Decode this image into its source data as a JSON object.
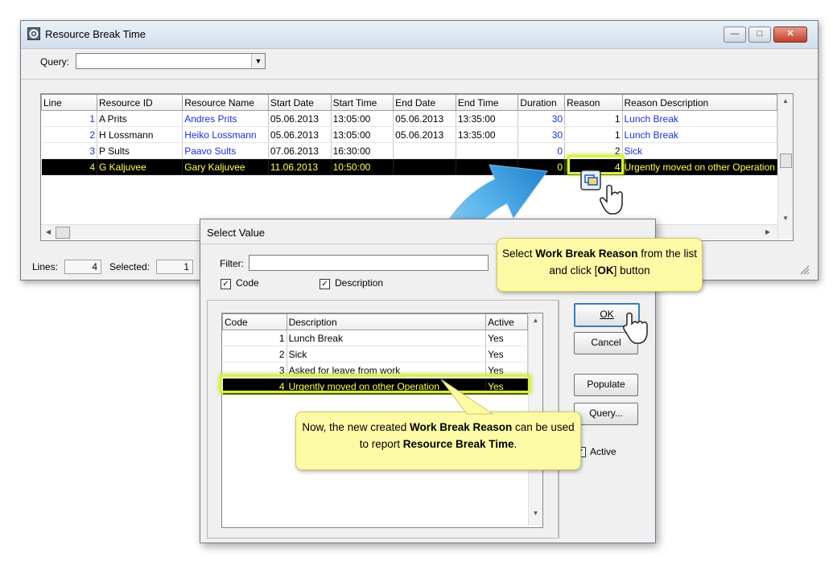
{
  "window": {
    "title": "Resource Break Time",
    "query_label": "Query:",
    "query_value": "",
    "min": "—",
    "max": "□",
    "close": "✕"
  },
  "grid": {
    "columns": [
      "Line",
      "Resource ID",
      "Resource Name",
      "Start Date",
      "Start Time",
      "End Date",
      "End Time",
      "Duration",
      "Reason",
      "Reason Description"
    ],
    "rows": [
      {
        "line": "1",
        "resource_id": "A Prits",
        "resource_name": "Andres Prits",
        "start_date": "05.06.2013",
        "start_time": "13:05:00",
        "end_date": "05.06.2013",
        "end_time": "13:35:00",
        "duration": "30",
        "reason": "1",
        "reason_desc": "Lunch Break"
      },
      {
        "line": "2",
        "resource_id": "H Lossmann",
        "resource_name": "Heiko Lossmann",
        "start_date": "05.06.2013",
        "start_time": "13:05:00",
        "end_date": "05.06.2013",
        "end_time": "13:35:00",
        "duration": "30",
        "reason": "1",
        "reason_desc": "Lunch Break"
      },
      {
        "line": "3",
        "resource_id": "P Sults",
        "resource_name": "Paavo Sults",
        "start_date": "07.06.2013",
        "start_time": "16:30:00",
        "end_date": "",
        "end_time": "",
        "duration": "0",
        "reason": "2",
        "reason_desc": "Sick"
      },
      {
        "line": "4",
        "resource_id": "G Kaljuvee",
        "resource_name": "Gary Kaljuvee",
        "start_date": "11.06.2013",
        "start_time": "10:50:00",
        "end_date": "",
        "end_time": "",
        "duration": "0",
        "reason": "4",
        "reason_desc": "Urgently moved on other Operation"
      }
    ]
  },
  "status": {
    "lines_label": "Lines:",
    "lines_value": "4",
    "selected_label": "Selected:",
    "selected_value": "1"
  },
  "dialog": {
    "title": "Select Value",
    "filter_label": "Filter:",
    "filter_value": "",
    "code_check_label": "Code",
    "desc_check_label": "Description",
    "columns": [
      "Code",
      "Description",
      "Active"
    ],
    "rows": [
      {
        "code": "1",
        "description": "Lunch Break",
        "active": "Yes"
      },
      {
        "code": "2",
        "description": "Sick",
        "active": "Yes"
      },
      {
        "code": "3",
        "description": "Asked for leave from work",
        "active": "Yes"
      },
      {
        "code": "4",
        "description": "Urgently moved on other Operation",
        "active": "Yes"
      }
    ],
    "ok": "OK",
    "cancel": "Cancel",
    "populate": "Populate",
    "query": "Query...",
    "active_label": "Active"
  },
  "callout1": {
    "p1": "Select ",
    "b1": "Work Break Reason",
    "p2": " from the list and click [",
    "b2": "OK",
    "p3": "] button"
  },
  "callout2": {
    "p1": "Now, the new created ",
    "b1": "Work Break Reason",
    "p2": " can be used to report ",
    "b2": "Resource Break Time",
    "p3": "."
  },
  "colors": {
    "selection_bg": "#000000",
    "selection_text": "#ffff55",
    "link_blue": "#1a2fd4",
    "callout": "#fdfaa6",
    "arrow": "#2a9ae0"
  }
}
